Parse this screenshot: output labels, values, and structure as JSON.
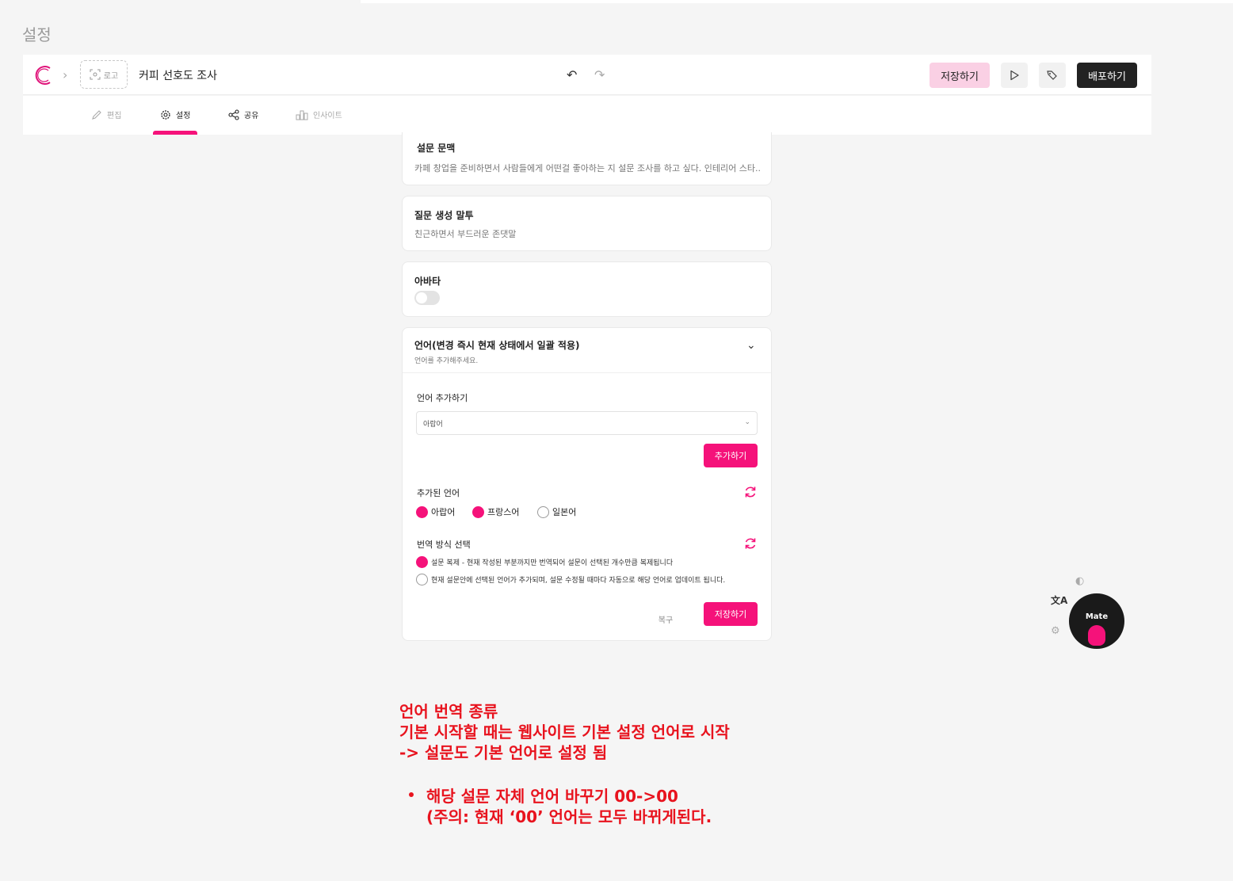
{
  "page_label": "설정",
  "header": {
    "logo_box_label": "로고",
    "doc_title": "커피 선호도 조사",
    "save_label": "저장하기",
    "deploy_label": "배포하기"
  },
  "tabs": [
    {
      "label": "편집",
      "icon": "pencil-icon",
      "active": false
    },
    {
      "label": "설정",
      "icon": "gear-icon",
      "active": true
    },
    {
      "label": "공유",
      "icon": "share-icon",
      "active": false
    },
    {
      "label": "인사이트",
      "icon": "bar-chart-icon",
      "active": false
    }
  ],
  "cards": {
    "context": {
      "title": "설문 문맥",
      "value": "카페 창업을 준비하면서 사람들에게 어떤걸 좋아하는 지 설문 조사를 하고 싶다. 인테리어 스타.."
    },
    "tone": {
      "title": "질문 생성 말투",
      "value": "친근하면서 부드러운 존댓말"
    },
    "avatar": {
      "title": "아바타",
      "enabled": false
    },
    "language": {
      "title": "언어(변경 즉시 현재 상태에서 일괄 적용)",
      "subtitle": "언어를 추가해주세요.",
      "add_label": "언어 추가하기",
      "select_value": "아랍어",
      "add_button": "추가하기",
      "added_label": "추가된 언어",
      "added_languages": [
        {
          "label": "아랍어",
          "checked": true
        },
        {
          "label": "프랑스어",
          "checked": true
        },
        {
          "label": "일본어",
          "checked": false
        }
      ],
      "method_label": "번역 방식 선택",
      "methods": [
        {
          "label": "설문 복제 - 현재 작성된 부분까지만 번역되어 설문이 선택된 개수만큼 복제됩니다",
          "checked": true
        },
        {
          "label": "현재 설문안에 선택된 언어가 추가되며, 설문 수정될 때마다 자동으로 해당 언어로 업데이트 됩니다.",
          "checked": false
        }
      ],
      "reset_button": "복구",
      "save_button": "저장하기"
    }
  },
  "mate_label": "Mate",
  "annotation": {
    "line1": "언어 번역 종류",
    "line2": "기본 시작할 때는 웹사이트 기본 설정 언어로 시작",
    "line3": "->  설문도 기본 언어로 설정 됨",
    "bullet_line1": "해당 설문 자체 언어 바꾸기 00->00",
    "bullet_line2": "(주의: 현재 ‘00’ 언어는 모두 바뀌게된다."
  },
  "colors": {
    "accent": "#f5127a",
    "accent_light": "#fad0e4",
    "annotation": "#e8131e",
    "dark": "#222222"
  }
}
